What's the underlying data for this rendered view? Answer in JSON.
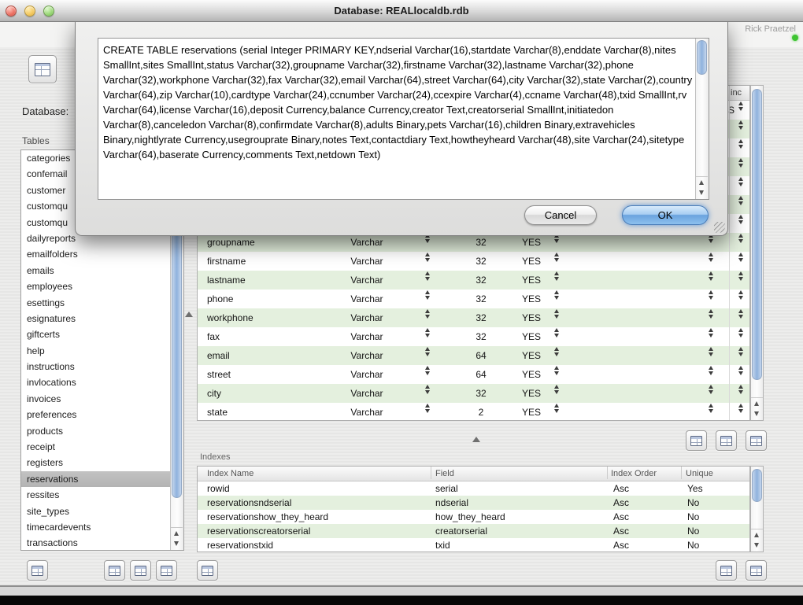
{
  "window": {
    "title": "Database: REALlocaldb.rdb",
    "presenter": "Rick Praetzel"
  },
  "sidebar": {
    "database_label": "Database:",
    "tables_label": "Tables",
    "selected_index": 20,
    "tables": [
      "categories",
      "confemail",
      "customer",
      "customqu",
      "customqu",
      "dailyreports",
      "emailfolders",
      "emails",
      "employees",
      "esettings",
      "esignatures",
      "giftcerts",
      "help",
      "instructions",
      "invlocations",
      "invoices",
      "preferences",
      "products",
      "receipt",
      "registers",
      "reservations",
      "ressites",
      "site_types",
      "timecardevents",
      "transactions"
    ]
  },
  "sheet": {
    "sql_text": "CREATE TABLE reservations (serial Integer PRIMARY KEY,ndserial Varchar(16),startdate Varchar(8),enddate Varchar(8),nites SmallInt,sites SmallInt,status Varchar(32),groupname Varchar(32),firstname Varchar(32),lastname Varchar(32),phone Varchar(32),workphone Varchar(32),fax Varchar(32),email Varchar(64),street Varchar(64),city Varchar(32),state Varchar(2),country Varchar(64),zip Varchar(10),cardtype Varchar(24),ccnumber Varchar(24),ccexpire Varchar(4),ccname Varchar(48),txid SmallInt,rv Varchar(64),license Varchar(16),deposit Currency,balance Currency,creator Text,creatorserial SmallInt,initiatedon Varchar(8),canceledon Varchar(8),confirmdate Varchar(8),adults Binary,pets Varchar(16),children Binary,extravehicles Binary,nightlyrate Currency,usegrouprate Binary,notes Text,contactdiary Text,howtheyheard Varchar(48),site Varchar(24),sitetype Varchar(64),baserate Currency,comments Text,netdown Text)",
    "cancel_label": "Cancel",
    "ok_label": "OK"
  },
  "fields": {
    "header_partial_label": "inc",
    "first_hidden_row_partial": "S",
    "hidden_rows_visible_steppers": 7,
    "visible_rows": [
      {
        "name": "groupname",
        "type": "Varchar",
        "size": "32",
        "allow_null": "YES"
      },
      {
        "name": "firstname",
        "type": "Varchar",
        "size": "32",
        "allow_null": "YES"
      },
      {
        "name": "lastname",
        "type": "Varchar",
        "size": "32",
        "allow_null": "YES"
      },
      {
        "name": "phone",
        "type": "Varchar",
        "size": "32",
        "allow_null": "YES"
      },
      {
        "name": "workphone",
        "type": "Varchar",
        "size": "32",
        "allow_null": "YES"
      },
      {
        "name": "fax",
        "type": "Varchar",
        "size": "32",
        "allow_null": "YES"
      },
      {
        "name": "email",
        "type": "Varchar",
        "size": "64",
        "allow_null": "YES"
      },
      {
        "name": "street",
        "type": "Varchar",
        "size": "64",
        "allow_null": "YES"
      },
      {
        "name": "city",
        "type": "Varchar",
        "size": "32",
        "allow_null": "YES"
      },
      {
        "name": "state",
        "type": "Varchar",
        "size": "2",
        "allow_null": "YES"
      }
    ]
  },
  "indexes": {
    "section_label": "Indexes",
    "columns": [
      "Index Name",
      "Field",
      "Index Order",
      "Unique"
    ],
    "rows": [
      {
        "index_name": "rowid",
        "field": "serial",
        "order": "Asc",
        "unique": "Yes"
      },
      {
        "index_name": "reservationsndserial",
        "field": "ndserial",
        "order": "Asc",
        "unique": "No"
      },
      {
        "index_name": "reservationshow_they_heard",
        "field": "how_they_heard",
        "order": "Asc",
        "unique": "No"
      },
      {
        "index_name": "reservationscreatorserial",
        "field": "creatorserial",
        "order": "Asc",
        "unique": "No"
      },
      {
        "index_name": "reservationstxid",
        "field": "txid",
        "order": "Asc",
        "unique": "No"
      }
    ]
  },
  "colors": {
    "stripe_green": "#e4f0de",
    "sel_gray": "#c2c2c2",
    "ok_blue": "#6ba3de",
    "dot_green": "#3ec431"
  }
}
